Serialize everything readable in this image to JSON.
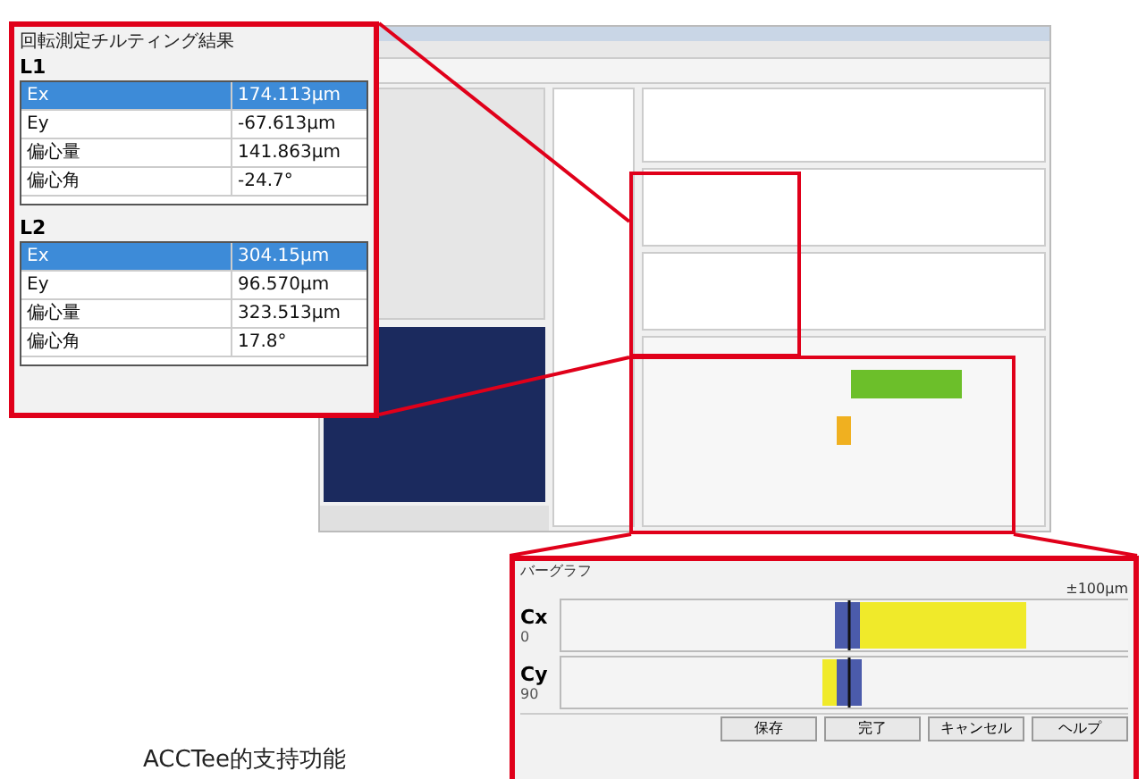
{
  "result_panel": {
    "title": "回転測定チルティング結果",
    "groups": [
      {
        "label": "L1",
        "rows": [
          {
            "name": "Ex",
            "value": "174.113μm",
            "selected": true
          },
          {
            "name": "Ey",
            "value": "-67.613μm",
            "selected": false
          },
          {
            "name": "偏心量",
            "value": "141.863μm",
            "selected": false
          },
          {
            "name": "偏心角",
            "value": "-24.7°",
            "selected": false
          }
        ]
      },
      {
        "label": "L2",
        "rows": [
          {
            "name": "Ex",
            "value": "304.15μm",
            "selected": true
          },
          {
            "name": "Ey",
            "value": "96.570μm",
            "selected": false
          },
          {
            "name": "偏心量",
            "value": "323.513μm",
            "selected": false
          },
          {
            "name": "偏心角",
            "value": "17.8°",
            "selected": false
          }
        ]
      }
    ]
  },
  "bar_panel": {
    "title": "バーグラフ",
    "scale": "±100μm",
    "bars": [
      {
        "name": "Cx",
        "value": "0"
      },
      {
        "name": "Cy",
        "value": "90"
      }
    ],
    "buttons": [
      "保存",
      "完了",
      "キャンセル",
      "ヘルプ"
    ]
  },
  "caption": "ACCTee的支持功能"
}
